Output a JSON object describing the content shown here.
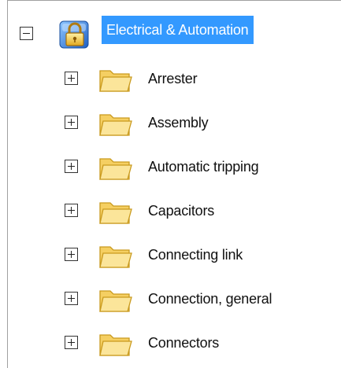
{
  "tree": {
    "root": {
      "label": "Electrical & Automation",
      "icon": "lock-folder-icon",
      "expanded": true,
      "selected": true
    },
    "children": [
      {
        "label": "Arrester",
        "icon": "folder-icon",
        "expanded": false
      },
      {
        "label": "Assembly",
        "icon": "folder-icon",
        "expanded": false
      },
      {
        "label": "Automatic tripping",
        "icon": "folder-icon",
        "expanded": false
      },
      {
        "label": "Capacitors",
        "icon": "folder-icon",
        "expanded": false
      },
      {
        "label": "Connecting link",
        "icon": "folder-icon",
        "expanded": false
      },
      {
        "label": "Connection, general",
        "icon": "folder-icon",
        "expanded": false
      },
      {
        "label": "Connectors",
        "icon": "folder-icon",
        "expanded": false
      }
    ]
  },
  "colors": {
    "selection": "#3399ff",
    "folder_fill": "#f9dc7a",
    "folder_edge": "#c99a1e",
    "border": "#a0a0a0"
  }
}
